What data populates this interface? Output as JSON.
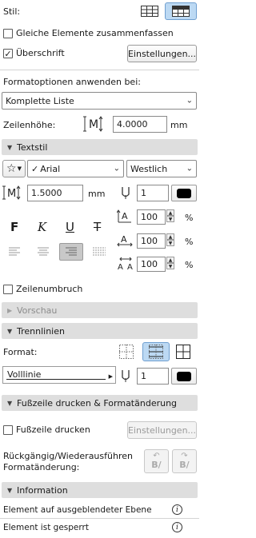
{
  "stil": {
    "label": "Stil:"
  },
  "options": {
    "gleiche_label": "Gleiche Elemente zusammenfassen",
    "ueberschrift_label": "Überschrift",
    "einstellungen_label": "Einstellungen..."
  },
  "format": {
    "anwenden_label": "Formatoptionen anwenden bei:",
    "anwenden_value": "Komplette Liste",
    "zeilenhoehe_label": "Zeilenhöhe:",
    "zeilenhoehe_value": "4.0000",
    "zeilenhoehe_unit": "mm"
  },
  "textstil": {
    "header": "Textstil",
    "font_value": "Arial",
    "script_value": "Westlich",
    "size_value": "1.5000",
    "size_unit": "mm",
    "pen_value": "1",
    "bold_glyph": "F",
    "italic_glyph": "K",
    "underline_glyph": "U",
    "strike_glyph": "T",
    "scale_width": "100",
    "scale_spacing": "100",
    "scale_char": "100",
    "percent": "%",
    "zeilenumbruch_label": "Zeilenumbruch"
  },
  "vorschau": {
    "header": "Vorschau"
  },
  "trennlinien": {
    "header": "Trennlinien",
    "format_label": "Format:",
    "linetype_value": "Volllinie",
    "pen_value": "1"
  },
  "fusszeile": {
    "header": "Fußzeile drucken & Formatänderung",
    "drucken_label": "Fußzeile drucken",
    "einstellungen_label": "Einstellungen...",
    "rueckgaengig_line1": "Rückgängig/Wiederausführen",
    "rueckgaengig_line2": "Formatänderung:",
    "undo_glyph": "B/",
    "redo_glyph": "B/"
  },
  "information": {
    "header": "Information",
    "rows": [
      {
        "text": "Element auf ausgeblendeter Ebene"
      },
      {
        "text": "Element ist gesperrt"
      }
    ]
  },
  "colors": {
    "accent": "#bcd9f3",
    "section_bg": "#dedede"
  }
}
